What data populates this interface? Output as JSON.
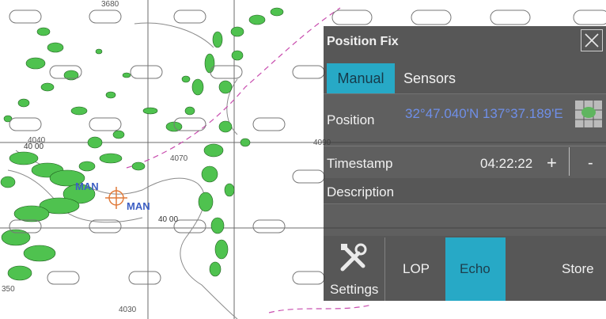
{
  "chart": {
    "contour_labels": [
      "3680",
      "4040",
      "4070",
      "4030",
      "4090",
      "350"
    ],
    "lat_label": "40 00",
    "lat_label_2": "40 00",
    "man_label_1": "MAN",
    "man_label_2": "MAN",
    "obstruction_symbol": "✳ ✳"
  },
  "dialog": {
    "title": "Position Fix",
    "close_icon": "close-icon",
    "tabs": [
      {
        "label": "Manual",
        "active": true
      },
      {
        "label": "Sensors",
        "active": false
      }
    ],
    "position_label": "Position",
    "position_value": "32°47.040'N 137°37.189'E",
    "timestamp_label": "Timestamp",
    "timestamp_value": "04:22:22",
    "plus_label": "+",
    "minus_label": "-",
    "description_label": "Description",
    "toolbar": {
      "settings_label": "Settings",
      "lop_label": "LOP",
      "echo_label": "Echo",
      "store_label": "Store"
    }
  },
  "colors": {
    "accent": "#27a9c6",
    "vegetation": "#4fc24f",
    "man": "#3d5fc4",
    "crosshair": "#e07a3a",
    "route": "#c84cae"
  }
}
